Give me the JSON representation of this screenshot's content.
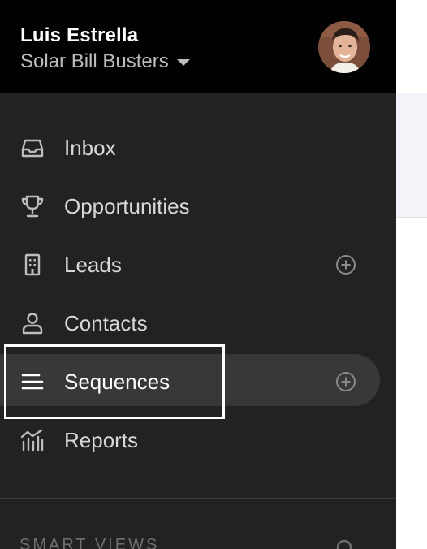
{
  "user": {
    "name": "Luis Estrella",
    "organization": "Solar Bill Busters"
  },
  "nav": {
    "items": [
      {
        "label": "Inbox",
        "icon": "inbox-icon",
        "has_add": false,
        "active": false
      },
      {
        "label": "Opportunities",
        "icon": "trophy-icon",
        "has_add": false,
        "active": false
      },
      {
        "label": "Leads",
        "icon": "building-icon",
        "has_add": true,
        "active": false
      },
      {
        "label": "Contacts",
        "icon": "person-icon",
        "has_add": false,
        "active": false
      },
      {
        "label": "Sequences",
        "icon": "list-lines-icon",
        "has_add": true,
        "active": true
      },
      {
        "label": "Reports",
        "icon": "bar-chart-icon",
        "has_add": false,
        "active": false
      }
    ]
  },
  "smart_views": {
    "heading": "SMART VIEWS",
    "icon": "search-icon"
  },
  "colors": {
    "header_bg": "#000000",
    "sidebar_bg": "#222222",
    "active_bg": "#383838",
    "nav_text": "#d8d8d8",
    "muted_icon": "#8a8a8a"
  }
}
